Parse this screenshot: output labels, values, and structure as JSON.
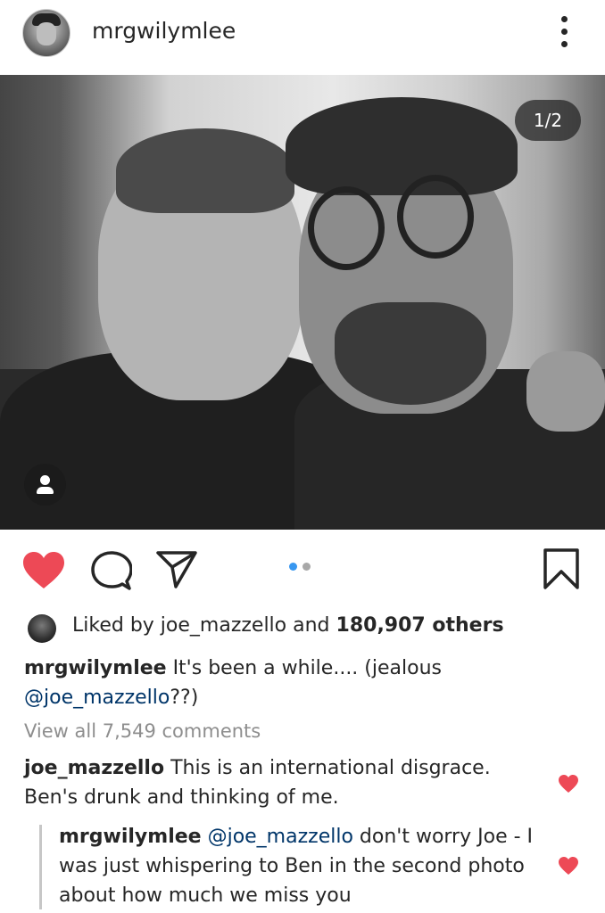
{
  "header": {
    "username": "mrgwilymlee",
    "avatar_icon": "profile-avatar",
    "more_icon": "more-vertical-icon"
  },
  "photo": {
    "counter": "1/2",
    "tag_icon": "person-icon"
  },
  "actions": {
    "like_icon": "heart-filled-icon",
    "comment_icon": "comment-icon",
    "share_icon": "send-icon",
    "save_icon": "bookmark-icon",
    "carousel_pages": 2,
    "carousel_active": 1,
    "colors": {
      "like": "#ed4956",
      "active_dot": "#3897f0",
      "inactive_dot": "#a8a8a8"
    }
  },
  "likes": {
    "prefix": "Liked by ",
    "user": "joe_mazzello",
    "middle": " and ",
    "count": "180,907 others"
  },
  "caption": {
    "author": "mrgwilymlee",
    "text_before": " It's been a while.... (jealous ",
    "mention": "@joe_mazzello",
    "text_after": "??)"
  },
  "view_all": "View all 7,549 comments",
  "comments": [
    {
      "author": "joe_mazzello",
      "text": " This is an international disgrace. Ben's drunk and thinking of me.",
      "liked": true
    },
    {
      "author": "mrgwilymlee",
      "mention": "@joe_mazzello",
      "text": " don't worry Joe - I was just whispering to Ben in the second photo about how much we miss you",
      "liked": true
    }
  ]
}
